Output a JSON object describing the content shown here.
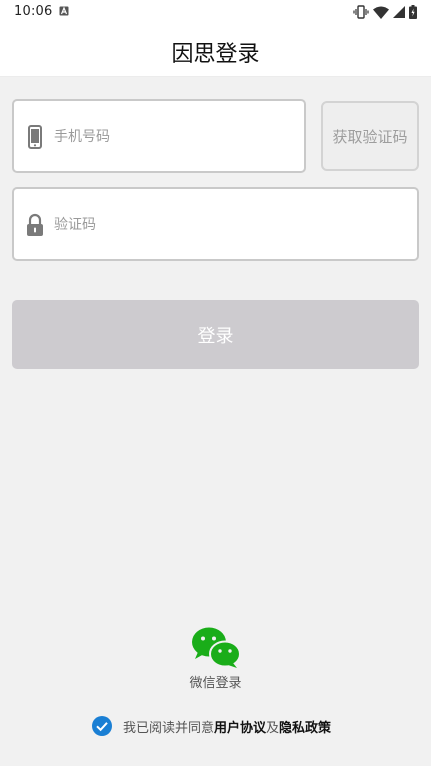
{
  "status_bar": {
    "time": "10:06"
  },
  "header": {
    "title": "因思登录"
  },
  "form": {
    "phone_placeholder": "手机号码",
    "phone_value": "",
    "code_placeholder": "验证码",
    "code_value": "",
    "get_code_label": "获取验证码",
    "login_label": "登录"
  },
  "wechat": {
    "label": "微信登录",
    "icon": "wechat-icon",
    "color": "#1aad19"
  },
  "agreement": {
    "checked": true,
    "prefix": "我已阅读并同意",
    "user_agreement": "用户协议",
    "and": "及",
    "privacy_policy": "隐私政策",
    "checkbox_color": "#1a7fd4"
  },
  "colors": {
    "background": "#f1f1f1",
    "login_button_disabled": "#cdcbcf"
  }
}
